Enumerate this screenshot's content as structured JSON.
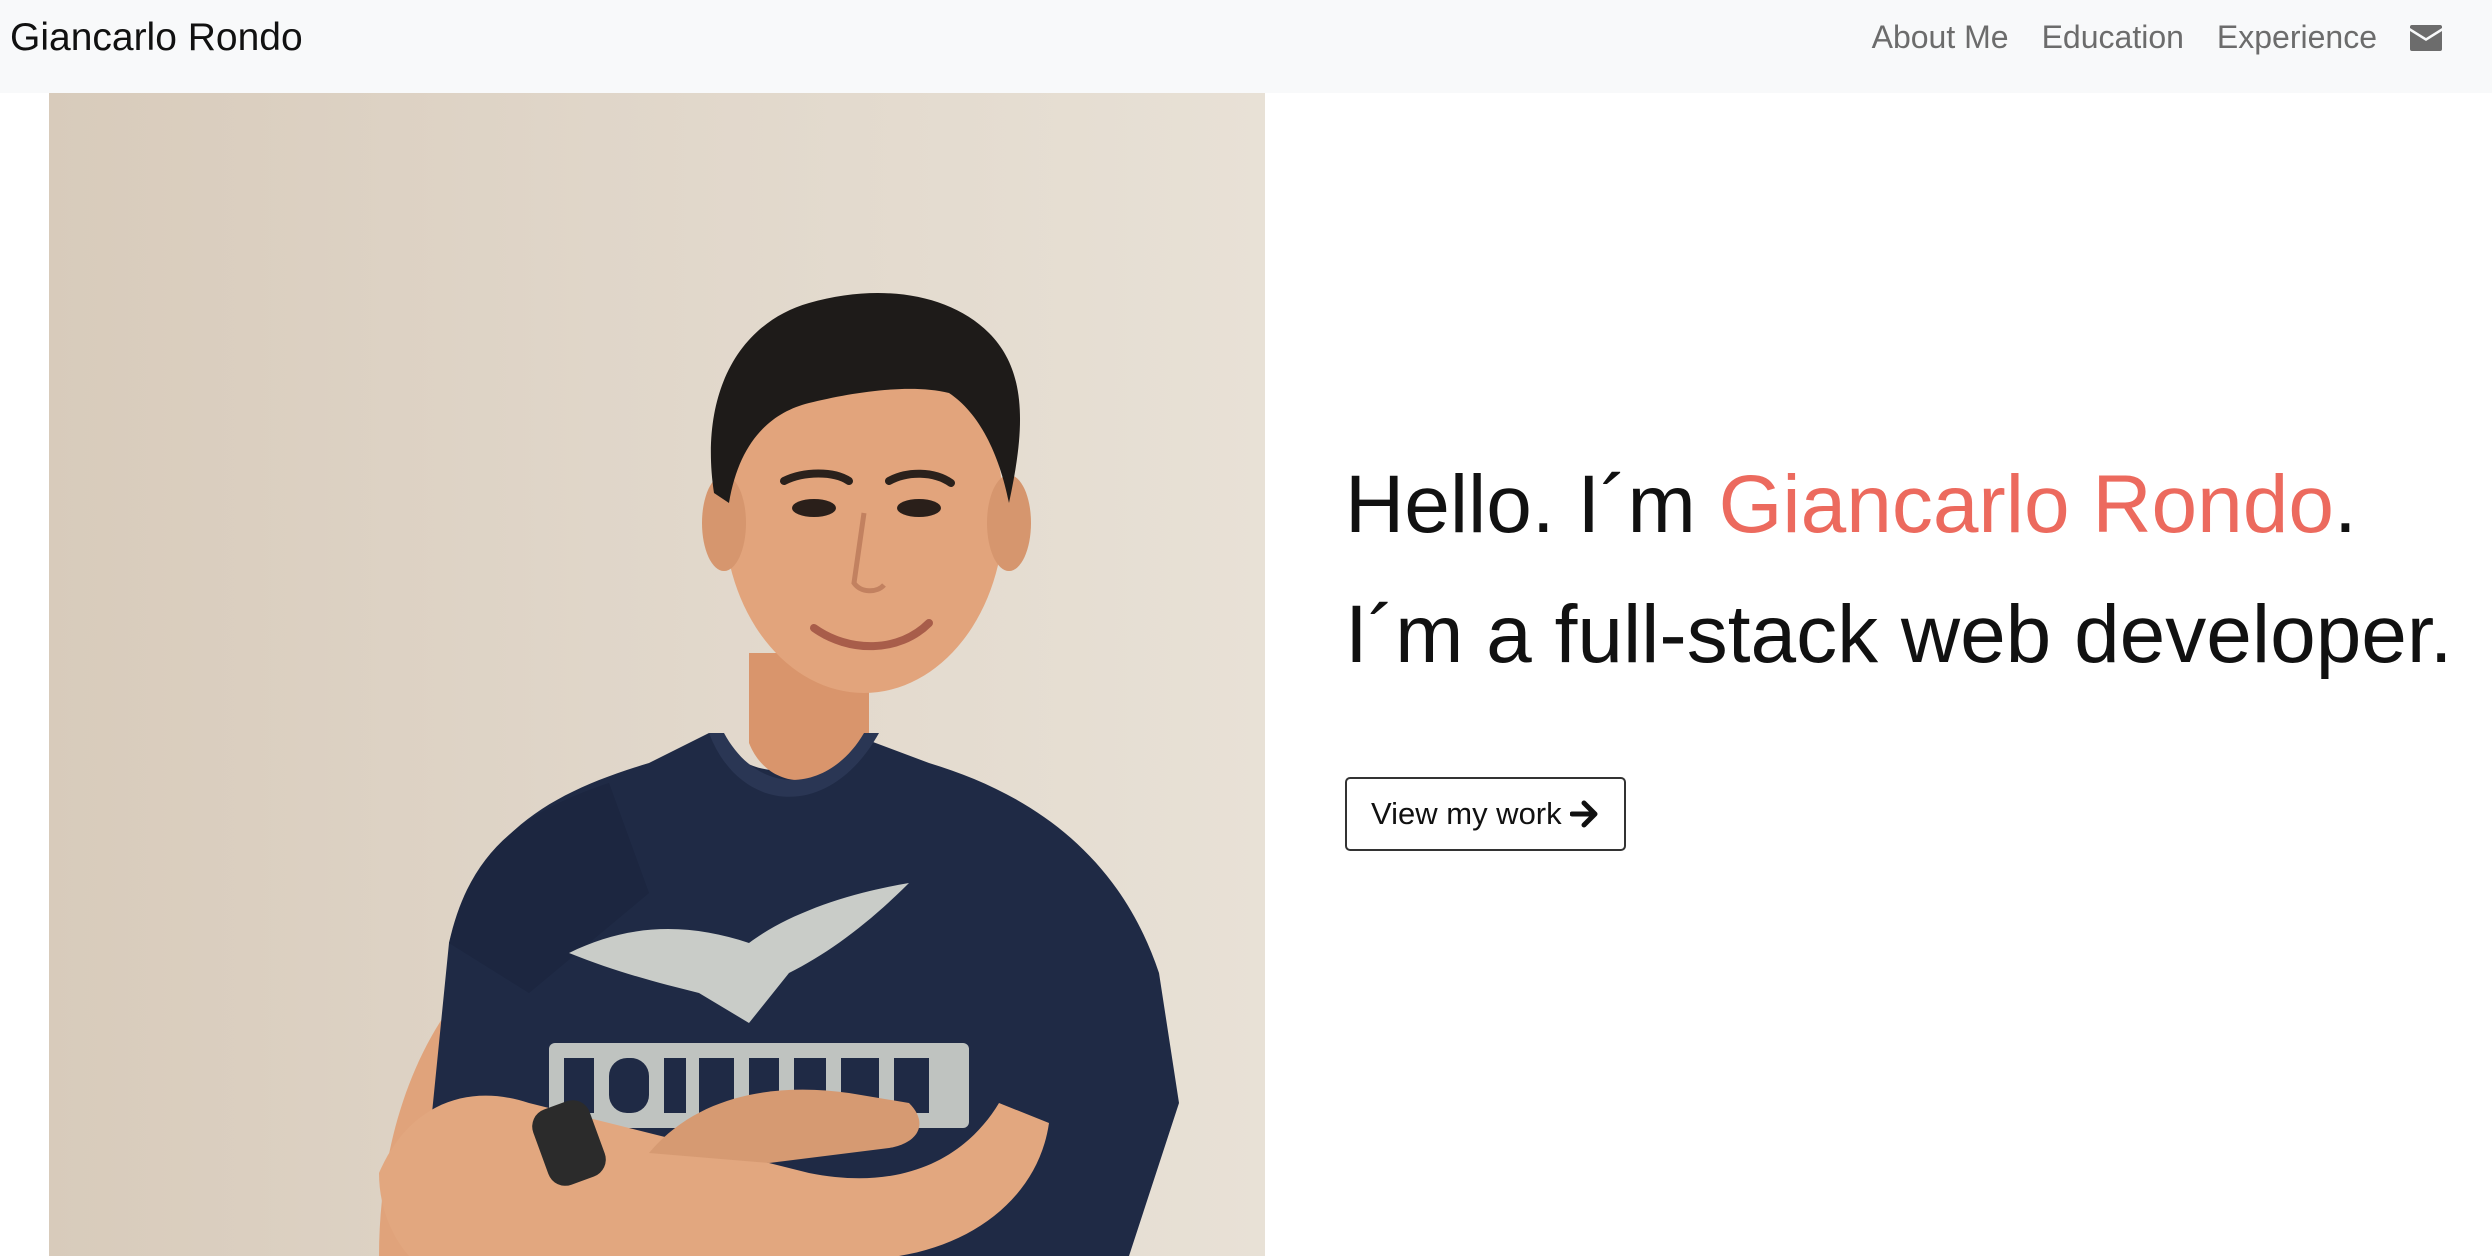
{
  "navbar": {
    "brand": "Giancarlo Rondo",
    "links": [
      {
        "label": "About Me"
      },
      {
        "label": "Education"
      },
      {
        "label": "Experience"
      }
    ],
    "contact_icon": "envelope-icon"
  },
  "hero": {
    "greeting_prefix": "Hello. I´m ",
    "name": "Giancarlo Rondo",
    "greeting_suffix": ".",
    "tagline": "I´m a full-stack web developer.",
    "cta_label": "View my work",
    "cta_icon": "arrow-right-icon"
  },
  "colors": {
    "accent": "#ec6a5e",
    "navbar_bg": "#f8f9fa",
    "photo_bg": "#e0d6c9"
  }
}
